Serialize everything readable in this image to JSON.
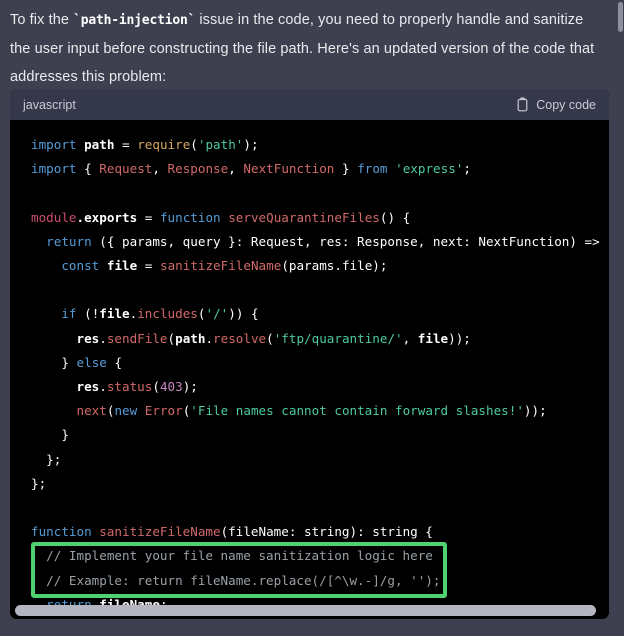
{
  "theme": {
    "page_background": "#3e404f",
    "code_background": "#000000",
    "code_header_background": "#35374a",
    "highlight_border": "#4fd071",
    "text_color": "#e9eaee",
    "scrollbar_color": "#b3b6c0"
  },
  "intro": {
    "part1": "To fix the ",
    "inline_code": "`path-injection`",
    "part2": " issue in the code, you need to properly handle and sanitize the user input before constructing the file path. Here's an updated version of the code that addresses this problem:"
  },
  "code_block": {
    "language_label": "javascript",
    "copy_label": "Copy code",
    "copy_icon": "clipboard-icon",
    "lines": [
      "import path = require('path');",
      "import { Request, Response, NextFunction } from 'express';",
      "",
      "module.exports = function serveQuarantineFiles() {",
      "  return ({ params, query }: Request, res: Response, next: NextFunction) =>",
      "    const file = sanitizeFileName(params.file);",
      "",
      "    if (!file.includes('/')) {",
      "      res.sendFile(path.resolve('ftp/quarantine/', file));",
      "    } else {",
      "      res.status(403);",
      "      next(new Error('File names cannot contain forward slashes!'));",
      "    }",
      "  };",
      "};",
      "",
      "function sanitizeFileName(fileName: string): string {",
      "  // Implement your file name sanitization logic here",
      "  // Example: return fileName.replace(/[^\\w.-]/g, '');",
      "  return fileName;",
      "}"
    ],
    "highlighted_lines": [
      "// Implement your file name sanitization logic here",
      "// Example: return fileName.replace(/[^\\w.-]/g, '');"
    ]
  },
  "scrollbars": {
    "horizontal_present": true,
    "vertical_present": true
  }
}
